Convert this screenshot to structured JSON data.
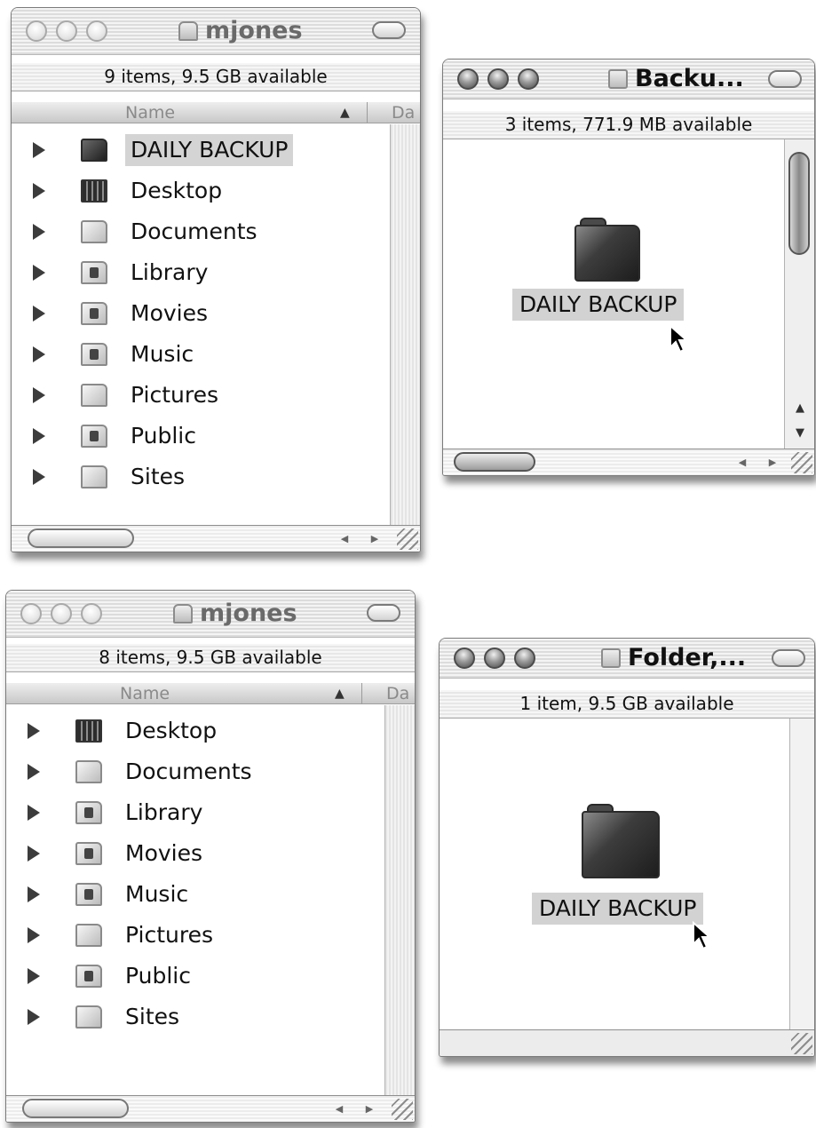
{
  "top": {
    "home_window": {
      "title": "mjones",
      "status": "9 items, 9.5 GB available",
      "column_name": "Name",
      "column_sort": "▲",
      "column_date": "Da",
      "items": [
        {
          "label": "DAILY BACKUP",
          "icon": "folder-dark-icon",
          "selected": true
        },
        {
          "label": "Desktop",
          "icon": "desktop-folder-icon"
        },
        {
          "label": "Documents",
          "icon": "documents-folder-icon"
        },
        {
          "label": "Library",
          "icon": "library-folder-icon"
        },
        {
          "label": "Movies",
          "icon": "movies-folder-icon"
        },
        {
          "label": "Music",
          "icon": "music-folder-icon"
        },
        {
          "label": "Pictures",
          "icon": "pictures-folder-icon"
        },
        {
          "label": "Public",
          "icon": "public-folder-icon"
        },
        {
          "label": "Sites",
          "icon": "sites-folder-icon"
        }
      ]
    },
    "backup_window": {
      "title": "Backu...",
      "status": "3 items, 771.9 MB available",
      "item_label": "DAILY BACKUP"
    }
  },
  "bottom": {
    "home_window": {
      "title": "mjones",
      "status": "8 items, 9.5 GB available",
      "column_name": "Name",
      "column_sort": "▲",
      "column_date": "Da",
      "items": [
        {
          "label": "Desktop",
          "icon": "desktop-folder-icon"
        },
        {
          "label": "Documents",
          "icon": "documents-folder-icon"
        },
        {
          "label": "Library",
          "icon": "library-folder-icon"
        },
        {
          "label": "Movies",
          "icon": "movies-folder-icon"
        },
        {
          "label": "Music",
          "icon": "music-folder-icon"
        },
        {
          "label": "Pictures",
          "icon": "pictures-folder-icon"
        },
        {
          "label": "Public",
          "icon": "public-folder-icon"
        },
        {
          "label": "Sites",
          "icon": "sites-folder-icon"
        }
      ]
    },
    "folder_window": {
      "title": "Folder,...",
      "status": "1 item, 9.5 GB available",
      "item_label": "DAILY BACKUP"
    }
  },
  "scroll_arrows": {
    "left": "◀",
    "right": "▶",
    "up": "▲",
    "down": "▼"
  }
}
